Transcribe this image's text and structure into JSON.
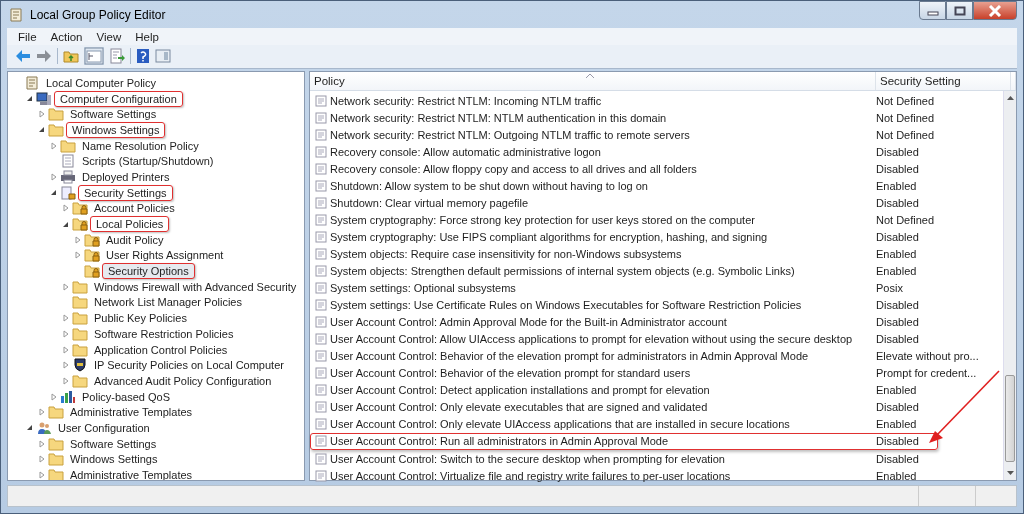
{
  "window": {
    "title": "Local Group Policy Editor"
  },
  "menu": [
    "File",
    "Action",
    "View",
    "Help"
  ],
  "tree": [
    {
      "label": "Local Computer Policy",
      "kind": "policy",
      "highlighted": false,
      "selected": false,
      "children": [
        {
          "label": "Computer Configuration",
          "kind": "computer",
          "expanded": true,
          "highlighted": true,
          "selected": false,
          "children": [
            {
              "label": "Software Settings",
              "kind": "folder",
              "expanded": false,
              "highlighted": false,
              "selected": false
            },
            {
              "label": "Windows Settings",
              "kind": "folder",
              "expanded": true,
              "highlighted": true,
              "selected": false,
              "children": [
                {
                  "label": "Name Resolution Policy",
                  "kind": "folder",
                  "expanded": false,
                  "highlighted": false,
                  "selected": false
                },
                {
                  "label": "Scripts (Startup/Shutdown)",
                  "kind": "script",
                  "highlighted": false,
                  "selected": false
                },
                {
                  "label": "Deployed Printers",
                  "kind": "printer",
                  "expanded": false,
                  "highlighted": false,
                  "selected": false
                },
                {
                  "label": "Security Settings",
                  "kind": "security",
                  "expanded": true,
                  "highlighted": true,
                  "selected": false,
                  "children": [
                    {
                      "label": "Account Policies",
                      "kind": "lockfolder",
                      "expanded": false,
                      "highlighted": false,
                      "selected": false
                    },
                    {
                      "label": "Local Policies",
                      "kind": "lockfolder",
                      "expanded": true,
                      "highlighted": true,
                      "selected": false,
                      "children": [
                        {
                          "label": "Audit Policy",
                          "kind": "lockfolder",
                          "expanded": false,
                          "highlighted": false,
                          "selected": false
                        },
                        {
                          "label": "User Rights Assignment",
                          "kind": "lockfolder",
                          "expanded": false,
                          "highlighted": false,
                          "selected": false
                        },
                        {
                          "label": "Security Options",
                          "kind": "lockfolder",
                          "highlighted": true,
                          "selected": true
                        }
                      ]
                    },
                    {
                      "label": "Windows Firewall with Advanced Security",
                      "kind": "folder",
                      "expanded": false,
                      "highlighted": false,
                      "selected": false
                    },
                    {
                      "label": "Network List Manager Policies",
                      "kind": "folder",
                      "highlighted": false,
                      "selected": false
                    },
                    {
                      "label": "Public Key Policies",
                      "kind": "folder",
                      "expanded": false,
                      "highlighted": false,
                      "selected": false
                    },
                    {
                      "label": "Software Restriction Policies",
                      "kind": "folder",
                      "expanded": false,
                      "highlighted": false,
                      "selected": false
                    },
                    {
                      "label": "Application Control Policies",
                      "kind": "folder",
                      "expanded": false,
                      "highlighted": false,
                      "selected": false
                    },
                    {
                      "label": "IP Security Policies on Local Computer",
                      "kind": "ipsec",
                      "expanded": false,
                      "highlighted": false,
                      "selected": false
                    },
                    {
                      "label": "Advanced Audit Policy Configuration",
                      "kind": "folder",
                      "expanded": false,
                      "highlighted": false,
                      "selected": false
                    }
                  ]
                },
                {
                  "label": "Policy-based QoS",
                  "kind": "qos",
                  "expanded": false,
                  "highlighted": false,
                  "selected": false
                }
              ]
            },
            {
              "label": "Administrative Templates",
              "kind": "folder",
              "expanded": false,
              "highlighted": false,
              "selected": false
            }
          ]
        },
        {
          "label": "User Configuration",
          "kind": "user",
          "expanded": true,
          "highlighted": false,
          "selected": false,
          "children": [
            {
              "label": "Software Settings",
              "kind": "folder",
              "expanded": false,
              "highlighted": false,
              "selected": false
            },
            {
              "label": "Windows Settings",
              "kind": "folder",
              "expanded": false,
              "highlighted": false,
              "selected": false
            },
            {
              "label": "Administrative Templates",
              "kind": "folder",
              "expanded": false,
              "highlighted": false,
              "selected": false
            }
          ]
        }
      ]
    }
  ],
  "table": {
    "columns": [
      "Policy",
      "Security Setting"
    ],
    "rows": [
      {
        "policy": "Network security: Restrict NTLM: Incoming NTLM traffic",
        "setting": "Not Defined",
        "highlighted": false
      },
      {
        "policy": "Network security: Restrict NTLM: NTLM authentication in this domain",
        "setting": "Not Defined",
        "highlighted": false
      },
      {
        "policy": "Network security: Restrict NTLM: Outgoing NTLM traffic to remote servers",
        "setting": "Not Defined",
        "highlighted": false
      },
      {
        "policy": "Recovery console: Allow automatic administrative logon",
        "setting": "Disabled",
        "highlighted": false
      },
      {
        "policy": "Recovery console: Allow floppy copy and access to all drives and all folders",
        "setting": "Disabled",
        "highlighted": false
      },
      {
        "policy": "Shutdown: Allow system to be shut down without having to log on",
        "setting": "Enabled",
        "highlighted": false
      },
      {
        "policy": "Shutdown: Clear virtual memory pagefile",
        "setting": "Disabled",
        "highlighted": false
      },
      {
        "policy": "System cryptography: Force strong key protection for user keys stored on the computer",
        "setting": "Not Defined",
        "highlighted": false
      },
      {
        "policy": "System cryptography: Use FIPS compliant algorithms for encryption, hashing, and signing",
        "setting": "Disabled",
        "highlighted": false
      },
      {
        "policy": "System objects: Require case insensitivity for non-Windows subsystems",
        "setting": "Enabled",
        "highlighted": false
      },
      {
        "policy": "System objects: Strengthen default permissions of internal system objects (e.g. Symbolic Links)",
        "setting": "Enabled",
        "highlighted": false
      },
      {
        "policy": "System settings: Optional subsystems",
        "setting": "Posix",
        "highlighted": false
      },
      {
        "policy": "System settings: Use Certificate Rules on Windows Executables for Software Restriction Policies",
        "setting": "Disabled",
        "highlighted": false
      },
      {
        "policy": "User Account Control: Admin Approval Mode for the Built-in Administrator account",
        "setting": "Disabled",
        "highlighted": false
      },
      {
        "policy": "User Account Control: Allow UIAccess applications to prompt for elevation without using the secure desktop",
        "setting": "Disabled",
        "highlighted": false
      },
      {
        "policy": "User Account Control: Behavior of the elevation prompt for administrators in Admin Approval Mode",
        "setting": "Elevate without pro...",
        "highlighted": false
      },
      {
        "policy": "User Account Control: Behavior of the elevation prompt for standard users",
        "setting": "Prompt for credent...",
        "highlighted": false
      },
      {
        "policy": "User Account Control: Detect application installations and prompt for elevation",
        "setting": "Enabled",
        "highlighted": false
      },
      {
        "policy": "User Account Control: Only elevate executables that are signed and validated",
        "setting": "Disabled",
        "highlighted": false
      },
      {
        "policy": "User Account Control: Only elevate UIAccess applications that are installed in secure locations",
        "setting": "Enabled",
        "highlighted": false
      },
      {
        "policy": "User Account Control: Run all administrators in Admin Approval Mode",
        "setting": "Disabled",
        "highlighted": true
      },
      {
        "policy": "User Account Control: Switch to the secure desktop when prompting for elevation",
        "setting": "Disabled",
        "highlighted": false
      },
      {
        "policy": "User Account Control: Virtualize file and registry write failures to per-user locations",
        "setting": "Enabled",
        "highlighted": false
      }
    ]
  }
}
